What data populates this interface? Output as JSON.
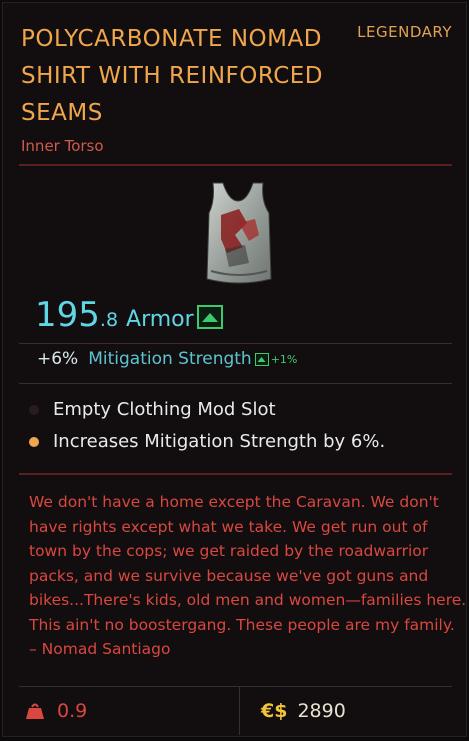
{
  "item": {
    "name": "POLYCARBONATE NOMAD SHIRT WITH REINFORCED SEAMS",
    "rarity": "LEGENDARY",
    "category": "Inner Torso"
  },
  "stats": {
    "armor_int": "195",
    "armor_dec": ".8",
    "armor_label": "Armor",
    "mitigation_value": "+6%",
    "mitigation_label": "Mitigation Strength",
    "mitigation_delta": "+1%"
  },
  "mods": [
    {
      "text": "Empty Clothing Mod Slot",
      "dot_color": "#2a1c1c"
    },
    {
      "text": "Increases Mitigation Strength by 6%.",
      "dot_color": "#f0a64c"
    }
  ],
  "lore": "We don't have a home except the Caravan. We don't have rights except what we take. We get run out of town by the cops; we get raided by the roadwarrior packs, and we survive because we've got guns and bikes...There's kids, old men and women—families here. This ain't no boostergang. These people are my family. – Nomad Santiago",
  "footer": {
    "weight": "0.9",
    "currency_symbol": "€$",
    "price": "2890"
  },
  "colors": {
    "title": "#f0a64c",
    "stat": "#5fd6e4",
    "upgrade": "#3ccb6a",
    "lore": "#d9473f"
  },
  "icons": [
    "item-shirt-image",
    "upgrade-arrow-icon",
    "weight-icon",
    "eurodollar-icon"
  ]
}
